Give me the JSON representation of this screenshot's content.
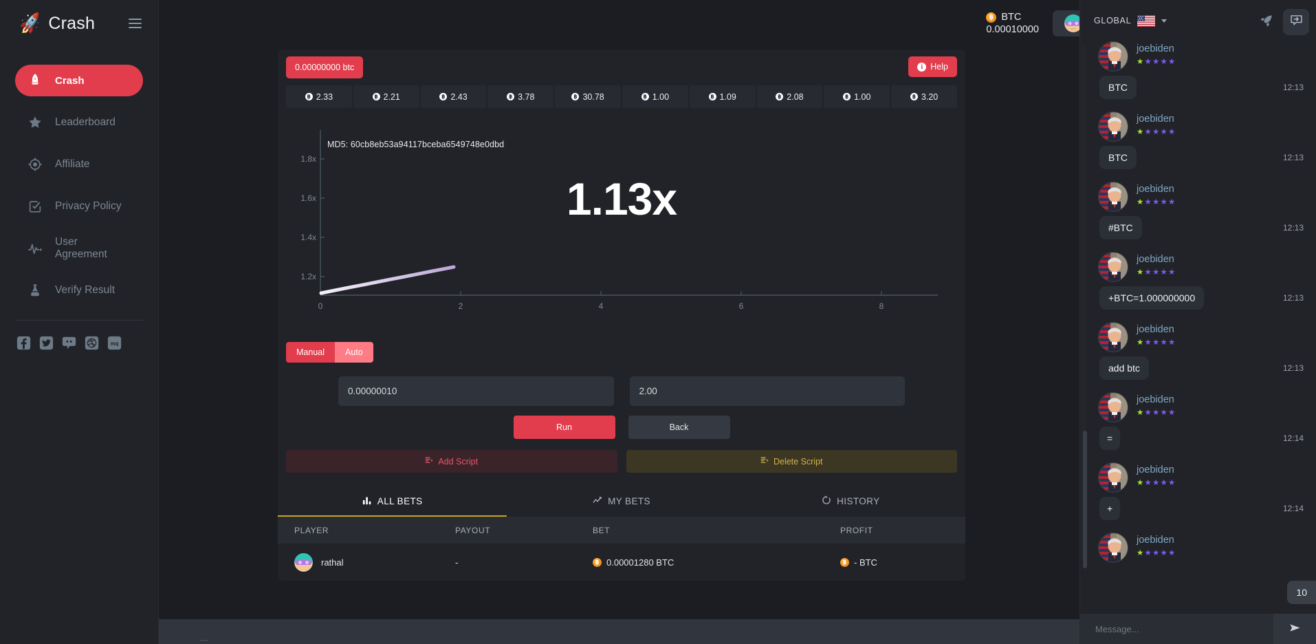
{
  "brand": {
    "name": "Crash",
    "logo_icon": "rocket-icon",
    "menu_icon": "hamburger-icon"
  },
  "sidebar": {
    "items": [
      {
        "label": "Crash",
        "icon": "rocket-icon",
        "active": true
      },
      {
        "label": "Leaderboard",
        "icon": "star-icon",
        "active": false
      },
      {
        "label": "Affiliate",
        "icon": "target-icon",
        "active": false
      },
      {
        "label": "Privacy Policy",
        "icon": "checkbox-icon",
        "active": false
      },
      {
        "label": "User Agreement",
        "icon": "pulse-icon",
        "active": false
      },
      {
        "label": "Verify Result",
        "icon": "flask-icon",
        "active": false
      }
    ],
    "socials": [
      {
        "name": "facebook-icon"
      },
      {
        "name": "twitter-icon"
      },
      {
        "name": "discord-icon"
      },
      {
        "name": "dribbble-icon"
      },
      {
        "name": "mq-icon"
      }
    ]
  },
  "topbar": {
    "currency": "BTC",
    "balance": "0.00010000",
    "coin_symbol": "฿",
    "avatar_icon": "user-avatar",
    "dropdown_icon": "chevron-down-icon",
    "bell_icon": "bell-icon",
    "chat_toggle_icon": "chat-toggle-icon"
  },
  "game": {
    "bet_chip": "0.00000000 btc",
    "help_label": "Help",
    "help_icon": "info-icon",
    "history": [
      "2.33",
      "2.21",
      "2.43",
      "3.78",
      "30.78",
      "1.00",
      "1.09",
      "2.08",
      "1.00",
      "3.20"
    ],
    "md5": "MD5: 60cb8eb53a94117bceba6549748e0dbd",
    "multiplier": "1.13x",
    "modes": [
      {
        "label": "Manual",
        "selected": true
      },
      {
        "label": "Auto",
        "selected": false
      }
    ],
    "bet_amount": "0.00000010",
    "auto_cashout": "2.00",
    "run_label": "Run",
    "back_label": "Back",
    "add_script_label": "Add Script",
    "delete_script_label": "Delete Script",
    "script_icon": "script-icon"
  },
  "chart_data": {
    "type": "line",
    "title": "",
    "xlabel": "",
    "ylabel": "",
    "x_ticks": [
      0,
      2,
      4,
      6,
      8
    ],
    "y_ticks": [
      "1.2x",
      "1.4x",
      "1.6x",
      "1.8x"
    ],
    "y_tick_values": [
      1.2,
      1.4,
      1.6,
      1.8
    ],
    "xlim": [
      0,
      9.2
    ],
    "ylim": [
      1.0,
      1.9
    ],
    "grid": false,
    "line_color_start": "#f3eef8",
    "line_color_end": "#bda6d8",
    "series": [
      {
        "name": "multiplier",
        "x": [
          0.0,
          0.2,
          0.4,
          0.6,
          0.8,
          1.0,
          1.2,
          1.4,
          1.6,
          1.8,
          1.9
        ],
        "y": [
          1.0,
          1.012,
          1.025,
          1.038,
          1.052,
          1.066,
          1.081,
          1.096,
          1.11,
          1.125,
          1.13
        ]
      }
    ],
    "current_value": 1.13
  },
  "bets": {
    "tabs": [
      {
        "label": "ALL BETS",
        "icon": "bar-chart-icon",
        "active": true
      },
      {
        "label": "MY BETS",
        "icon": "chart-icon",
        "active": false
      },
      {
        "label": "HISTORY",
        "icon": "clock-icon",
        "active": false
      }
    ],
    "columns": [
      "PLAYER",
      "PAYOUT",
      "BET",
      "PROFIT"
    ],
    "rows": [
      {
        "player": "rathal",
        "payout": "-",
        "bet": "0.00001280 BTC",
        "profit": "- BTC"
      }
    ]
  },
  "chat": {
    "channel": "GLOBAL",
    "flag_icon": "us-flag-icon",
    "dropdown_icon": "chevron-down-icon",
    "rocket_icon": "rocket-icon",
    "info_icon": "info-circle-icon",
    "unread_count": "10",
    "input_placeholder": "Message...",
    "send_icon": "send-icon",
    "messages": [
      {
        "user": "joebiden",
        "text": "BTC",
        "time": "12:13",
        "stars": 5
      },
      {
        "user": "joebiden",
        "text": "BTC",
        "time": "12:13",
        "stars": 5
      },
      {
        "user": "joebiden",
        "text": "#BTC",
        "time": "12:13",
        "stars": 5
      },
      {
        "user": "joebiden",
        "text": "+BTC=1.000000000",
        "time": "12:13",
        "stars": 5
      },
      {
        "user": "joebiden",
        "text": "add btc",
        "time": "12:13",
        "stars": 5
      },
      {
        "user": "joebiden",
        "text": "=",
        "time": "12:14",
        "stars": 5
      },
      {
        "user": "joebiden",
        "text": "+",
        "time": "12:14",
        "stars": 5
      },
      {
        "user": "joebiden",
        "text": "",
        "time": "",
        "stars": 5
      }
    ]
  },
  "colors": {
    "accent_red": "#e23d4d",
    "panel": "#212328",
    "background": "#1b1d22",
    "gold": "#c9a227",
    "btc_orange": "#f08c1a"
  }
}
